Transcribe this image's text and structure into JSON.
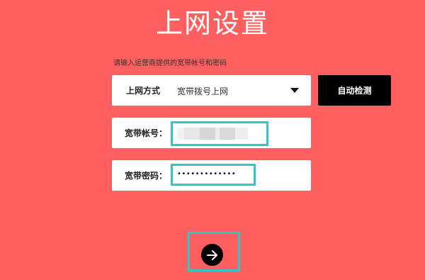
{
  "page": {
    "title": "上网设置",
    "hint": "请输入运营商提供的宽带帐号和密码"
  },
  "form": {
    "method_label": "上网方式",
    "method_value": "宽带拨号上网",
    "auto_detect_label": "自动检测",
    "account_label": "宽带帐号：",
    "password_label": "宽带密码：",
    "password_mask": "•••••••••••••"
  },
  "colors": {
    "background": "#ff5f5f",
    "highlight": "#2fc8c8",
    "button": "#000000"
  },
  "icons": {
    "dropdown": "chevron-down-icon",
    "next": "arrow-right-icon"
  }
}
